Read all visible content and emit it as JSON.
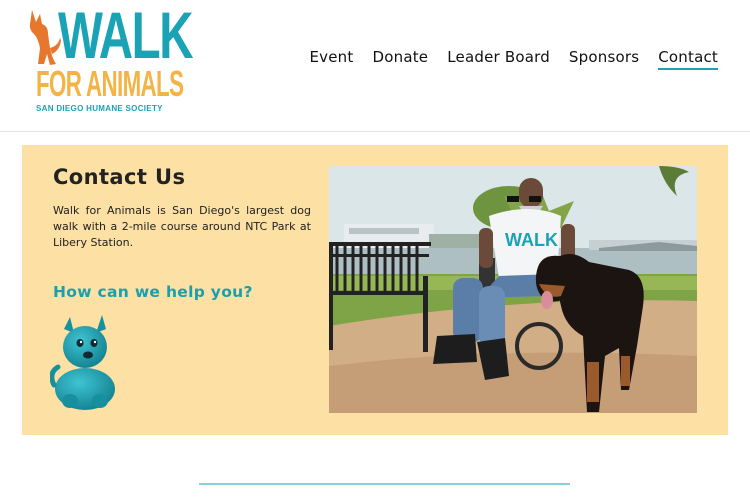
{
  "brand": {
    "logo_line1": "WALK",
    "logo_line2": "FOR ANIMALS",
    "logo_sub": "SAN DIEGO HUMANE SOCIETY",
    "colors": {
      "teal": "#1aa3b5",
      "orange": "#f4b445",
      "dog_orange": "#e8772e"
    }
  },
  "nav": {
    "items": [
      {
        "label": "Event"
      },
      {
        "label": "Donate"
      },
      {
        "label": "Leader Board"
      },
      {
        "label": "Sponsors"
      },
      {
        "label": "Contact",
        "active": true
      }
    ]
  },
  "contact": {
    "title": "Contact Us",
    "description": "Walk for Animals is San Diego's largest dog walk with a 2-mile course around NTC Park at Libery Station.",
    "help_heading": "How can we help you?",
    "panel_color": "#fde0a3",
    "mascot_icon": "blue-dog-mascot-icon",
    "photo_shirt_text": "WALK"
  }
}
